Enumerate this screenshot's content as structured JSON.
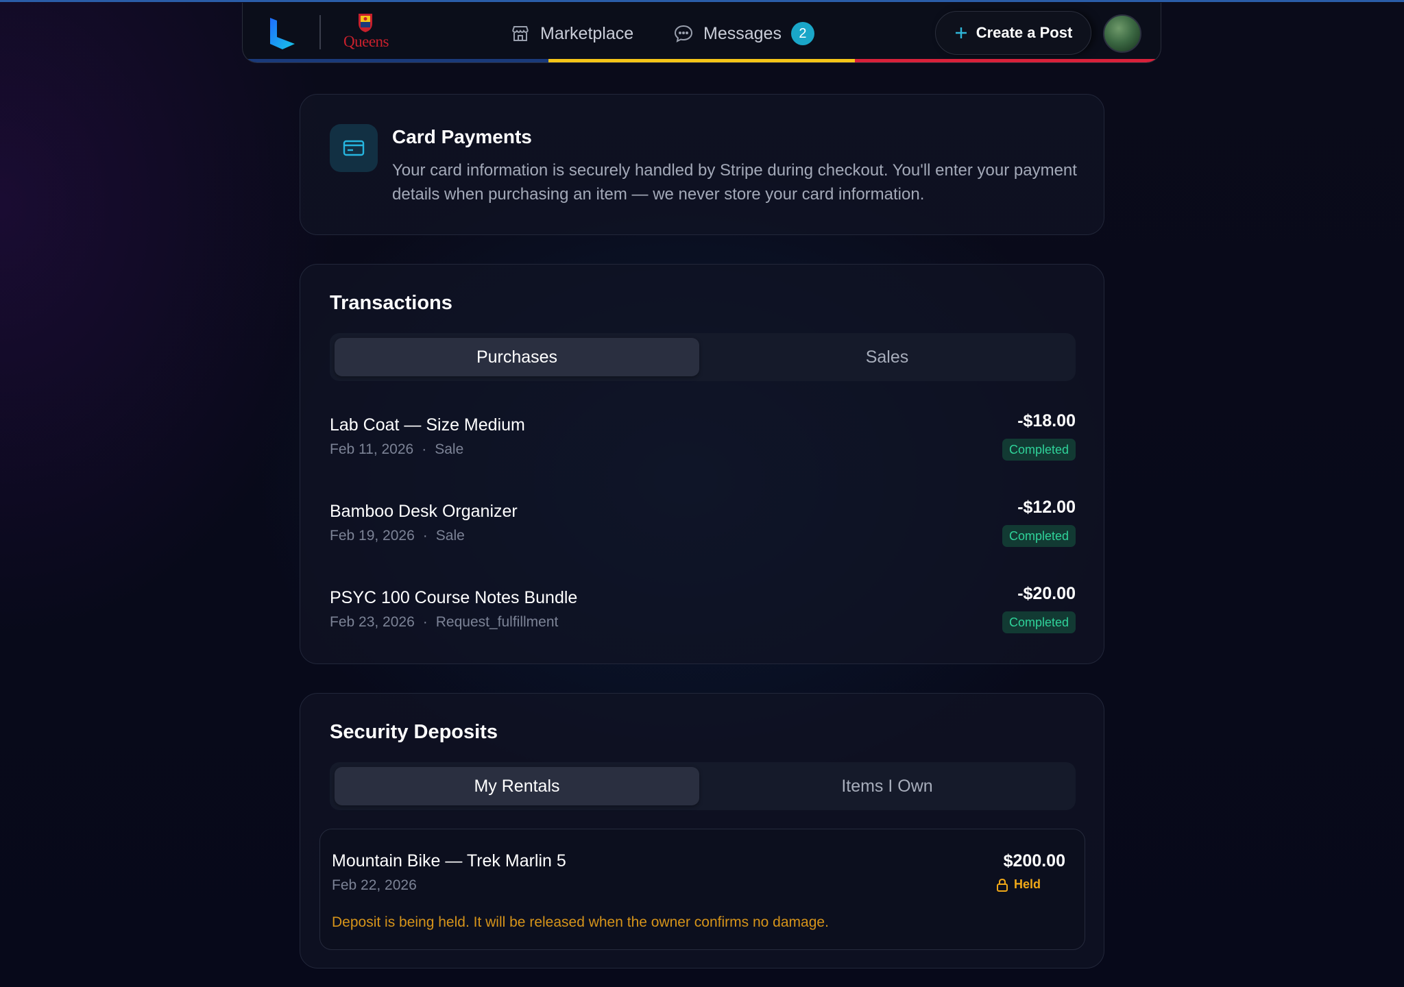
{
  "nav": {
    "marketplace_label": "Marketplace",
    "messages_label": "Messages",
    "messages_count": "2",
    "create_post_label": "Create a Post",
    "crest_text": "Queens",
    "stripe_colors": [
      "#1a3a7a",
      "#f5c518",
      "#d8213a"
    ]
  },
  "card_payments": {
    "icon": "credit-card-icon",
    "title": "Card Payments",
    "description": "Your card information is securely handled by Stripe during checkout. You'll enter your payment details when purchasing an item — we never store your card information."
  },
  "transactions": {
    "title": "Transactions",
    "tabs": [
      "Purchases",
      "Sales"
    ],
    "active_tab": "Purchases",
    "items": [
      {
        "name": "Lab Coat — Size Medium",
        "date": "Feb 11, 2026",
        "type": "Sale",
        "amount": "-$18.00",
        "status": "Completed"
      },
      {
        "name": "Bamboo Desk Organizer",
        "date": "Feb 19, 2026",
        "type": "Sale",
        "amount": "-$12.00",
        "status": "Completed"
      },
      {
        "name": "PSYC 100 Course Notes Bundle",
        "date": "Feb 23, 2026",
        "type": "Request_fulfillment",
        "amount": "-$20.00",
        "status": "Completed"
      }
    ]
  },
  "deposits": {
    "title": "Security Deposits",
    "tabs": [
      "My Rentals",
      "Items I Own"
    ],
    "active_tab": "My Rentals",
    "items": [
      {
        "name": "Mountain Bike — Trek Marlin 5",
        "date": "Feb 22, 2026",
        "amount": "$200.00",
        "status": "Held",
        "status_icon": "lock-icon",
        "note": "Deposit is being held. It will be released when the owner confirms no damage."
      }
    ]
  },
  "colors": {
    "accent": "#1aa6c8",
    "completed": "#2fd39a",
    "held": "#f0a818"
  }
}
